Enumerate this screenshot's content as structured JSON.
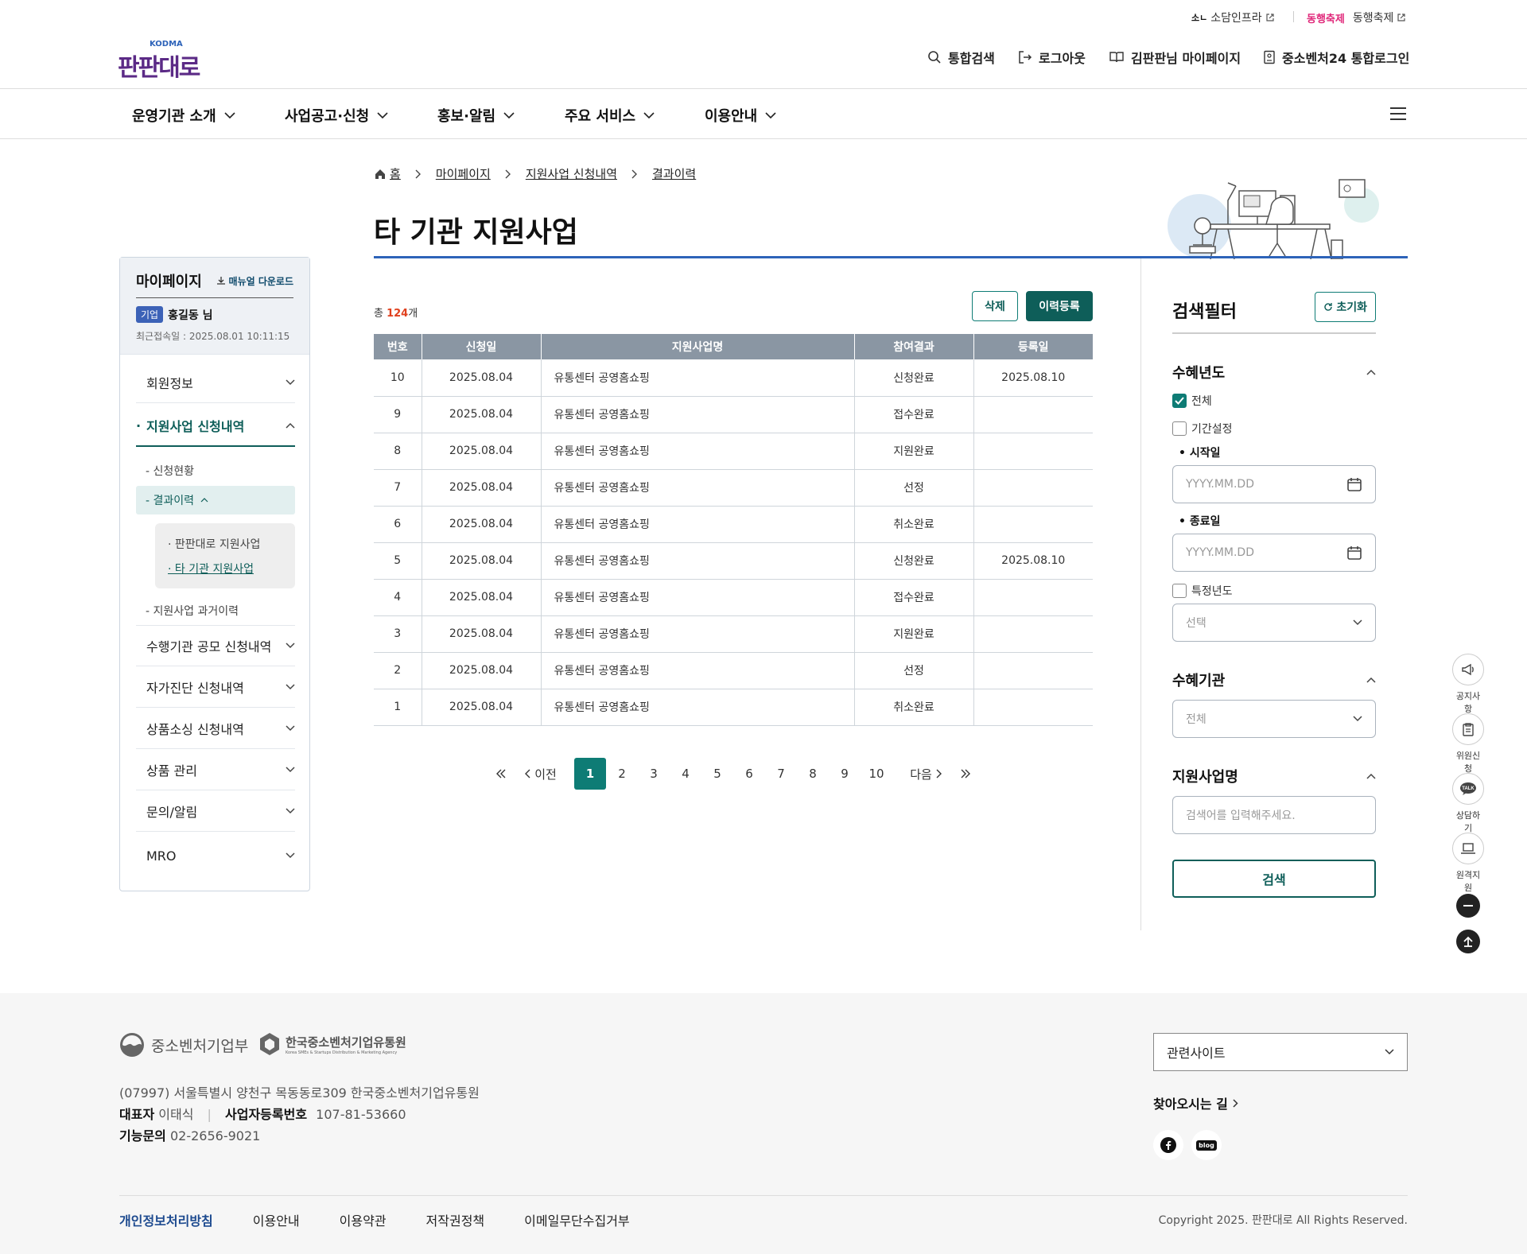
{
  "utility": {
    "item1": "소담인프라",
    "item2": "동행축제",
    "festival_logo": "동행축제"
  },
  "header": {
    "logo_text": "판판대로",
    "logo_sub": "KODMA",
    "search": "통합검색",
    "logout": "로그아웃",
    "mypage": "김판판님 마이페이지",
    "login24": "중소벤처24 통합로그인"
  },
  "mainnav": [
    "운영기관 소개",
    "사업공고·신청",
    "홍보·알림",
    "주요 서비스",
    "이용안내"
  ],
  "breadcrumb": [
    "홈",
    "마이페이지",
    "지원사업 신청내역",
    "결과이력"
  ],
  "page_title": "타 기관 지원사업",
  "sidebar": {
    "title": "마이페이지",
    "manual": "매뉴얼 다운로드",
    "badge": "기업",
    "user": "홍길동 님",
    "last_login": "최근접속일 : 2025.08.01 10:11:15",
    "items": {
      "member": "회원정보",
      "support": "지원사업 신청내역",
      "sub_status": "- 신청현황",
      "sub_result": "- 결과이력",
      "sub_sub1": "· 판판대로 지원사업",
      "sub_sub2": "· 타 기관 지원사업",
      "sub_past": "- 지원사업 과거이력",
      "agency": "수행기관 공모 신청내역",
      "selfdiag": "자가진단 신청내역",
      "sourcing": "상품소싱 신청내역",
      "product": "상품 관리",
      "inquiry": "문의/알림",
      "mro": "MRO"
    }
  },
  "list": {
    "total_prefix": "총 ",
    "total_count": "124",
    "total_suffix": "개",
    "delete": "삭제",
    "register": "이력등록",
    "headers": [
      "번호",
      "신청일",
      "지원사업명",
      "참여결과",
      "등록일"
    ],
    "rows": [
      [
        "10",
        "2025.08.04",
        "유통센터 공영홈쇼핑",
        "신청완료",
        "2025.08.10"
      ],
      [
        "9",
        "2025.08.04",
        "유통센터 공영홈쇼핑",
        "접수완료",
        ""
      ],
      [
        "8",
        "2025.08.04",
        "유통센터 공영홈쇼핑",
        "지원완료",
        ""
      ],
      [
        "7",
        "2025.08.04",
        "유통센터 공영홈쇼핑",
        "선정",
        ""
      ],
      [
        "6",
        "2025.08.04",
        "유통센터 공영홈쇼핑",
        "취소완료",
        ""
      ],
      [
        "5",
        "2025.08.04",
        "유통센터 공영홈쇼핑",
        "신청완료",
        "2025.08.10"
      ],
      [
        "4",
        "2025.08.04",
        "유통센터 공영홈쇼핑",
        "접수완료",
        ""
      ],
      [
        "3",
        "2025.08.04",
        "유통센터 공영홈쇼핑",
        "지원완료",
        ""
      ],
      [
        "2",
        "2025.08.04",
        "유통센터 공영홈쇼핑",
        "선정",
        ""
      ],
      [
        "1",
        "2025.08.04",
        "유통센터 공영홈쇼핑",
        "취소완료",
        ""
      ]
    ]
  },
  "pager": {
    "prev": "이전",
    "next": "다음",
    "pages": [
      "1",
      "2",
      "3",
      "4",
      "5",
      "6",
      "7",
      "8",
      "9",
      "10"
    ],
    "current": "1"
  },
  "filter": {
    "title": "검색필터",
    "reset": "초기화",
    "year_title": "수혜년도",
    "all": "전체",
    "period": "기간설정",
    "start_label": "시작일",
    "end_label": "종료일",
    "date_placeholder": "YYYY.MM.DD",
    "specific_year": "특정년도",
    "select_placeholder": "선택",
    "agency_title": "수혜기관",
    "agency_value": "전체",
    "name_title": "지원사업명",
    "name_placeholder": "검색어를 입력해주세요.",
    "search": "검색"
  },
  "quick": [
    "공지사항",
    "위원신청",
    "상담하기",
    "원격지원"
  ],
  "footer": {
    "ministry": "중소벤처기업부",
    "agency": "한국중소벤처기업유통원",
    "agency_en": "Korea SMEs & Startups Distribution & Marketing Agency",
    "address": "(07997) 서울특별시 양천구 목동동로309 한국중소벤처기업유통원",
    "rep_label": "대표자",
    "rep_value": "이태식",
    "biz_label": "사업자등록번호",
    "biz_value": "107-81-53660",
    "tech_label": "기능문의",
    "tech_value": "02-2656-9021",
    "related": "관련사이트",
    "directions": "찾아오시는 길",
    "links": [
      "개인정보처리방침",
      "이용안내",
      "이용약관",
      "저작권정책",
      "이메일무단수집거부"
    ],
    "copyright": "Copyright 2025. 판판대로 All Rights Reserved.",
    "blog": "blog"
  },
  "colors": {
    "primary": "#0e7c75",
    "accent_blue": "#2d63b9",
    "brand_purple": "#5b2a86",
    "count_red": "#e0401e"
  }
}
